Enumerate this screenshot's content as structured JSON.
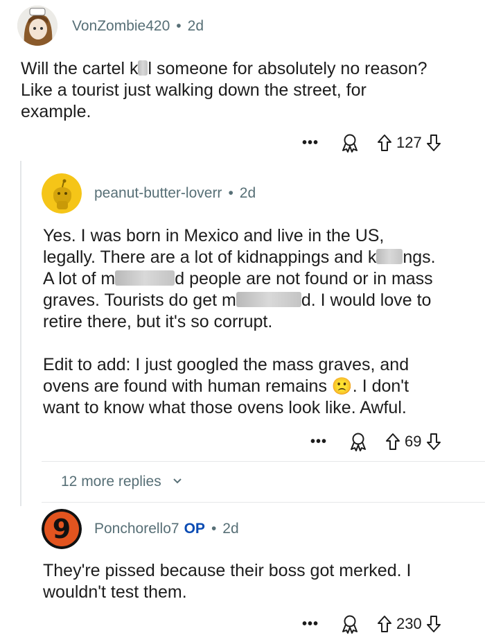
{
  "comments": [
    {
      "username": "VonZombie420",
      "age": "2d",
      "text_lines": [
        "Will the cartel k",
        "l someone for absolutely no reason?",
        "Like a tourist just walking down the street, for",
        "example."
      ],
      "votes": "127"
    },
    {
      "username": "peanut-butter-loverr",
      "age": "2d",
      "p1": {
        "l1": "Yes. I was born in Mexico and live in the US,",
        "l2a": "legally. There are a lot of kidnappings and k",
        "l2b": "ngs.",
        "l3a": "A lot of m",
        "l3b": "d people are not found or in mass",
        "l4a": "graves. Tourists do get m",
        "l4b": "d. I would love to",
        "l5": "retire there, but it's so corrupt."
      },
      "p2": {
        "l1": "Edit to add: I just googled the mass graves, and",
        "l2a": "ovens are found with human remains",
        "emoji": "🙁",
        "l2b": ". I don't",
        "l3": "want to know what those ovens look like. Awful."
      },
      "votes": "69"
    },
    {
      "username": "Ponchorello7",
      "op_badge": "OP",
      "age": "2d",
      "text_lines": [
        "They're pissed because their boss got merked. I",
        "wouldn't test them."
      ],
      "votes": "230"
    }
  ],
  "more_replies_label": "12 more replies",
  "more_dots": "•••",
  "separator": "•",
  "avatar3_glyph": "9",
  "colors": {
    "meta": "#576f76",
    "op": "#0a4bb3",
    "text": "#1c1c1c",
    "line": "#e3e6e8"
  },
  "icons": [
    "more-icon",
    "award-icon",
    "upvote-icon",
    "downvote-icon",
    "chevron-down-icon"
  ]
}
